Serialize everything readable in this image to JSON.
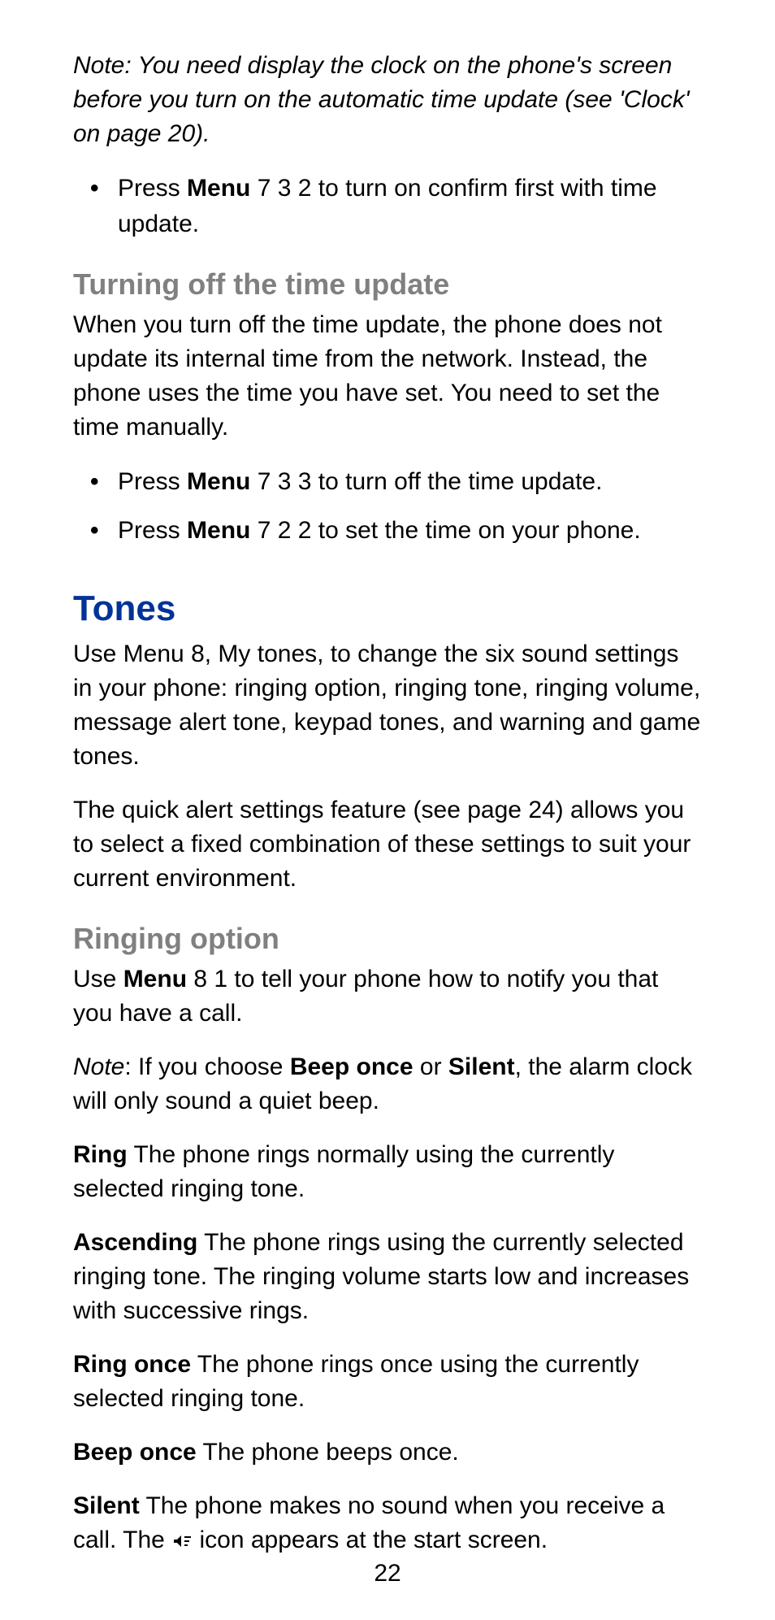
{
  "note1": "Note: You need display the clock on the phone's screen before you turn on the automatic time update  (see 'Clock' on page 20).",
  "bullet1": {
    "pre": "Press ",
    "bold": "Menu",
    "post": " 7 3 2 to turn on confirm first with time update."
  },
  "sub1": "Turning off the time update",
  "para1": "When you turn off the time update, the phone does not update its internal time from the network. Instead, the phone uses the time you have set. You need to set the time manually.",
  "bullet2": {
    "pre": "Press ",
    "bold": "Menu",
    "post": " 7 3 3  to turn off the time update."
  },
  "bullet3": {
    "pre": "Press ",
    "bold": "Menu",
    "post": " 7 2 2  to set the time on your phone."
  },
  "section1": "Tones",
  "para2": "Use Menu 8, My tones, to change the six sound settings in your phone: ringing option, ringing tone, ringing volume, message alert tone, keypad tones, and warning and game tones.",
  "para3": "The quick alert settings feature (see page 24) allows you to select a fixed combination of these settings to suit your current environment.",
  "sub2": "Ringing option",
  "para4": {
    "pre": "Use ",
    "bold": "Menu",
    "post": " 8 1 to tell your phone how to notify you that you have a call."
  },
  "note_word": "Note",
  "para5": {
    "pre": ":  If you choose ",
    "b1": "Beep once",
    "mid": " or ",
    "b2": "Silent",
    "post": ", the alarm clock will only sound a quiet beep."
  },
  "def1": {
    "term": "Ring",
    "desc": "  The phone rings normally using the currently selected ringing tone."
  },
  "def2": {
    "term": "Ascending",
    "desc": "  The phone rings using the currently selected ringing tone. The ringing volume starts low and increases with successive rings."
  },
  "def3": {
    "term": "Ring once",
    "desc": "  The phone rings once using the currently selected ringing tone."
  },
  "def4": {
    "term": "Beep once",
    "desc": "  The phone beeps once."
  },
  "def5": {
    "term": "Silent",
    "desc1": "  The phone makes no sound when you receive a call. The  ",
    "desc2": " icon appears at the start screen."
  },
  "page_number": "22"
}
